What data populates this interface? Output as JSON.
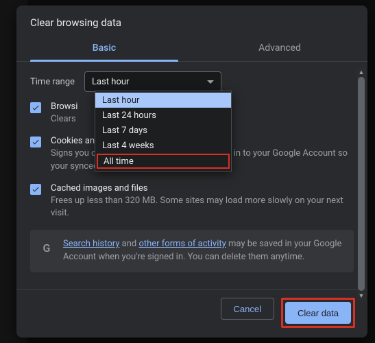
{
  "dialog": {
    "title": "Clear browsing data",
    "tabs": {
      "basic": "Basic",
      "advanced": "Advanced",
      "active": "basic"
    },
    "time_range": {
      "label": "Time range",
      "selected": "Last hour",
      "options": [
        "Last hour",
        "Last 24 hours",
        "Last 7 days",
        "Last 4 weeks",
        "All time"
      ],
      "highlighted_option": "Last hour",
      "annotated_option": "All time"
    },
    "items": [
      {
        "title": "Browsing history",
        "desc": "Clears history and autocompletions in the address bar.",
        "title_visible": "Browsi",
        "desc_visible": "Clears",
        "checked": true
      },
      {
        "title": "Cookies and other site data",
        "desc": "Signs you out of most sites. You'll stay signed in to your Google Account so your synced data can be cleared.",
        "checked": true
      },
      {
        "title": "Cached images and files",
        "desc": "Frees up less than 320 MB. Some sites may load more slowly on your next visit.",
        "checked": true
      }
    ],
    "info": {
      "icon": "G",
      "link1": "Search history",
      "mid1": " and ",
      "link2": "other forms of activity",
      "tail": " may be saved in your Google Account when you're signed in. You can delete them anytime."
    },
    "buttons": {
      "cancel": "Cancel",
      "confirm": "Clear data"
    }
  }
}
